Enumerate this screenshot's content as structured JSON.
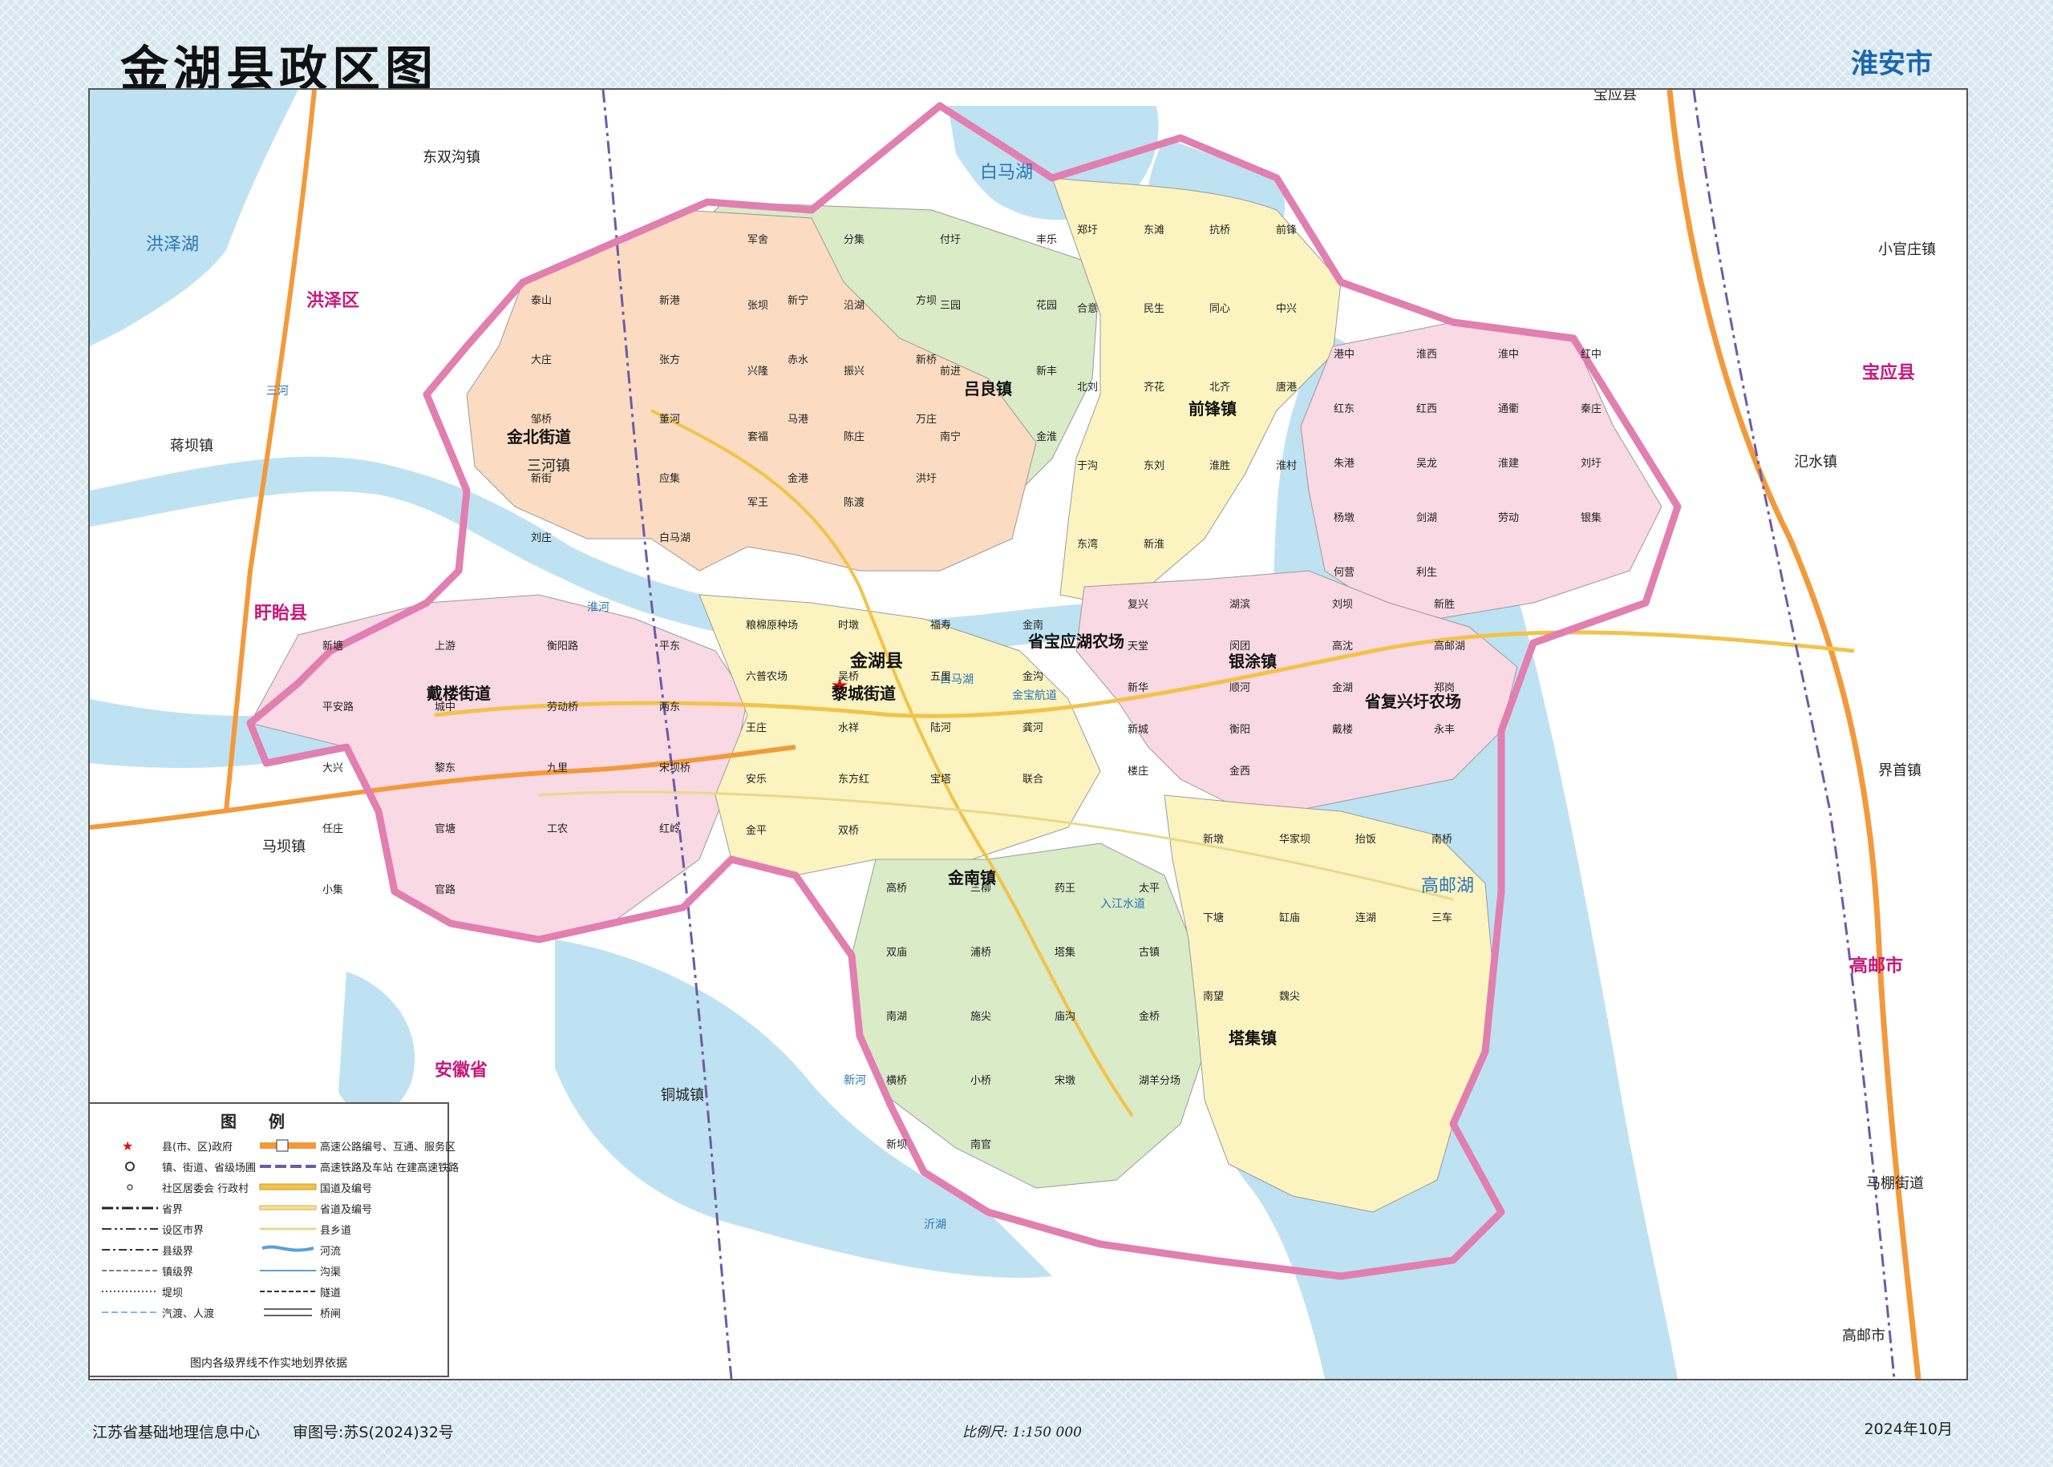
{
  "title": "金湖县政区图",
  "region_label": "淮安市",
  "county_seat": "金湖县",
  "neighbor_regions": [
    "洪泽区",
    "盱眙县",
    "安徽省",
    "宝应县",
    "高邮市"
  ],
  "lakes": [
    "洪泽湖",
    "白马湖",
    "高邮湖"
  ],
  "towns": [
    "戴楼街道",
    "金北街道",
    "黎城街道",
    "吕良镇",
    "前锋镇",
    "银涂镇",
    "金南镇",
    "塔集镇",
    "省宝应湖农场",
    "省复兴圩农场"
  ],
  "outside_places": [
    "东双沟镇",
    "蒋坝镇",
    "三河镇",
    "马坝镇",
    "铜城镇",
    "宝应县",
    "小官庄镇",
    "氾水镇",
    "界首镇",
    "马棚街道",
    "高邮市"
  ],
  "villages": [
    "军舍",
    "分集",
    "付圩",
    "丰乐",
    "张坝",
    "沿湖",
    "三园",
    "花园",
    "兴隆",
    "振兴",
    "前进",
    "新丰",
    "套福",
    "陈庄",
    "南宁",
    "金淮",
    "军王",
    "陈渡",
    "泰山",
    "新港",
    "新宁",
    "方坝",
    "大庄",
    "张方",
    "赤水",
    "新桥",
    "邹桥",
    "董河",
    "马港",
    "万庄",
    "新街",
    "应集",
    "金港",
    "洪圩",
    "刘庄",
    "白马湖",
    "郑圩",
    "东滩",
    "抗桥",
    "前锋",
    "合意",
    "民生",
    "同心",
    "中兴",
    "北刘",
    "齐花",
    "北齐",
    "唐港",
    "于沟",
    "东刘",
    "淮胜",
    "淮村",
    "东湾",
    "新淮",
    "港中",
    "淮西",
    "淮中",
    "红中",
    "红东",
    "红西",
    "通衢",
    "秦庄",
    "朱港",
    "吴龙",
    "淮建",
    "刘圩",
    "杨墩",
    "剑湖",
    "劳动",
    "银集",
    "何营",
    "利生",
    "复兴",
    "湖滨",
    "刘坝",
    "新胜",
    "天堂",
    "闵团",
    "高沈",
    "高邮湖",
    "新华",
    "顺河",
    "金湖",
    "郑岗",
    "新城",
    "衡阳",
    "戴楼",
    "永丰",
    "楼庄",
    "金西",
    "新塘",
    "上游",
    "衡阳路",
    "平东",
    "平安路",
    "城中",
    "劳动桥",
    "两东",
    "大兴",
    "黎东",
    "九里",
    "宋坝桥",
    "任庄",
    "官塘",
    "工农",
    "红岭",
    "小集",
    "官路",
    "粮棉原种场",
    "时墩",
    "福寿",
    "金南",
    "六普农场",
    "吴桥",
    "五里",
    "金沟",
    "王庄",
    "水祥",
    "陆河",
    "龚河",
    "安乐",
    "东方红",
    "宝塔",
    "联合",
    "金平",
    "双桥",
    "高桥",
    "三柳",
    "药王",
    "太平",
    "双庙",
    "浦桥",
    "塔集",
    "古镇",
    "南湖",
    "施尖",
    "庙沟",
    "金桥",
    "横桥",
    "小桥",
    "宋墩",
    "湖羊分场",
    "新坝",
    "南官",
    "新墩",
    "华家坝",
    "抬饭",
    "南桥",
    "下塘",
    "缸庙",
    "连湖",
    "三车",
    "南望",
    "魏尖"
  ],
  "rivers": [
    "三河",
    "淮河",
    "白马湖",
    "新河",
    "入江水道",
    "金宝航道",
    "沂湖"
  ],
  "legend": {
    "title": "图例",
    "left_items": [
      "县(市、区)政府",
      "镇、街道、省级场圃",
      "社区居委会 行政村",
      "省界",
      "设区市界",
      "县级界",
      "镇级界",
      "堤坝",
      "汽渡、人渡"
    ],
    "right_items": [
      "高速公路编号、互通、服务区",
      "高速铁路及车站 在建高速铁路",
      "国道及编号",
      "省道及编号",
      "县乡道",
      "河流",
      "沟渠",
      "隧道",
      "桥闸"
    ],
    "note": "图内各级界线不作实地划界依据"
  },
  "footer": {
    "organization": "江苏省基础地理信息中心",
    "approval": "审图号:苏S(2024)32号",
    "scale": "比例尺: 1:150 000",
    "date": "2024年10月"
  },
  "colors": {
    "water": "#bfe2f2",
    "county_border": "#e07fb0",
    "zone_pink": "#f9d9e3",
    "zone_orange": "#fbdcc2",
    "zone_yellow": "#fbf4c1",
    "zone_green": "#d9ebc7",
    "road": "#f2c24a",
    "highway": "#f29a3b",
    "railway": "#6e5aa8"
  }
}
